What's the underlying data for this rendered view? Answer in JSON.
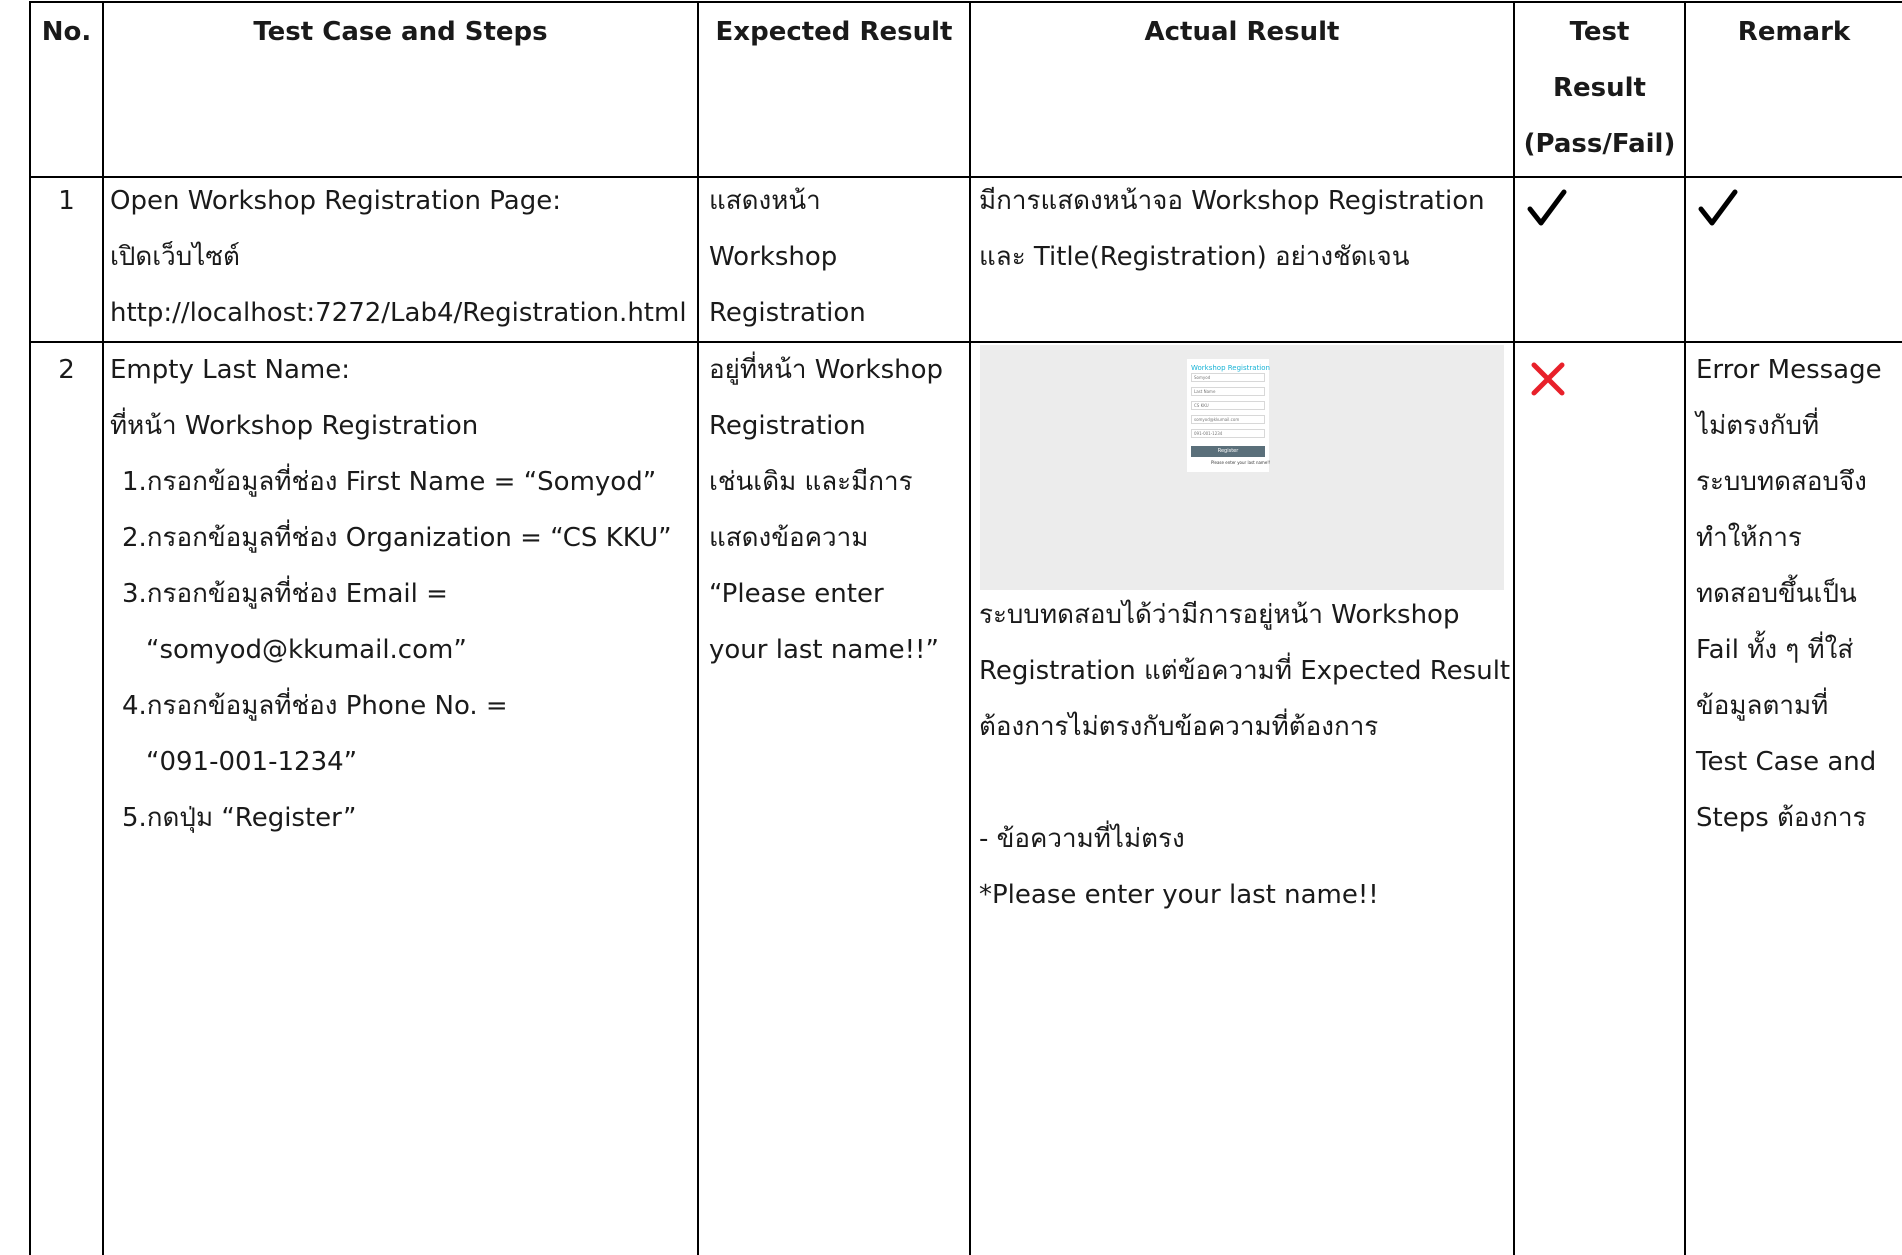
{
  "table": {
    "headers": {
      "no": "No.",
      "steps": "Test Case and Steps",
      "expected": "Expected Result",
      "actual": "Actual Result",
      "result": [
        "Test",
        "Result",
        "(Pass/Fail)"
      ],
      "remark": "Remark"
    },
    "row1": {
      "no": "1",
      "steps": [
        "Open Workshop Registration Page:",
        "เปิดเว็บไซต์",
        "http://localhost:7272/Lab4/Registration.html"
      ],
      "expected": [
        "แสดงหน้า",
        "Workshop",
        "Registration"
      ],
      "actual": [
        "มีการแสดงหน้าจอ Workshop Registration",
        "และ Title(Registration) อย่างชัดเจน"
      ],
      "result_icon": "check-icon",
      "remark_icon": "check-icon"
    },
    "row2": {
      "no": "2",
      "steps_intro": [
        "Empty Last Name:",
        "ที่หน้า Workshop Registration"
      ],
      "steps": [
        "1.กรอกข้อมูลที่ช่อง First Name = “Somyod”",
        "2.กรอกข้อมูลที่ช่อง Organization = “CS KKU”",
        "3.กรอกข้อมูลที่ช่อง Email =",
        "“somyod@kkumail.com”",
        "4.กรอกข้อมูลที่ช่อง Phone No. =",
        "“091-001-1234”",
        "5.กดปุ่ม “Register”"
      ],
      "expected": [
        "อยู่ที่หน้า Workshop",
        "Registration",
        "เช่นเดิม และมีการ",
        "แสดงข้อความ",
        "“Please enter",
        "your last name!!”"
      ],
      "actual": [
        "ระบบทดสอบได้ว่ามีการอยู่หน้า Workshop",
        "Registration แต่ข้อความที่ Expected Result",
        "ต้องการไม่ตรงกับข้อความที่ต้องการ",
        "",
        "- ข้อความที่ไม่ตรง",
        "*Please enter your last name!!"
      ],
      "result_icon": "cross-icon",
      "remark": [
        "Error Message",
        "ไม่ตรงกับที่",
        "ระบบทดสอบจึง",
        "ทำให้การ",
        "ทดสอบขึ้นเป็น",
        "Fail ทั้ง ๆ ที่ใส่",
        "ข้อมูลตามที่",
        "Test Case and",
        "Steps ต้องการ"
      ]
    },
    "screenshot": {
      "title": "Workshop Registration",
      "fields": [
        "Somyod",
        "Last Name",
        "CS KKU",
        "somyod@kkumail.com",
        "091-001-1234"
      ],
      "button": "Register",
      "message": "Please enter your last name!!"
    }
  },
  "colors": {
    "check": "#000000",
    "cross": "#e8202a",
    "accent": "#19b3d6"
  }
}
